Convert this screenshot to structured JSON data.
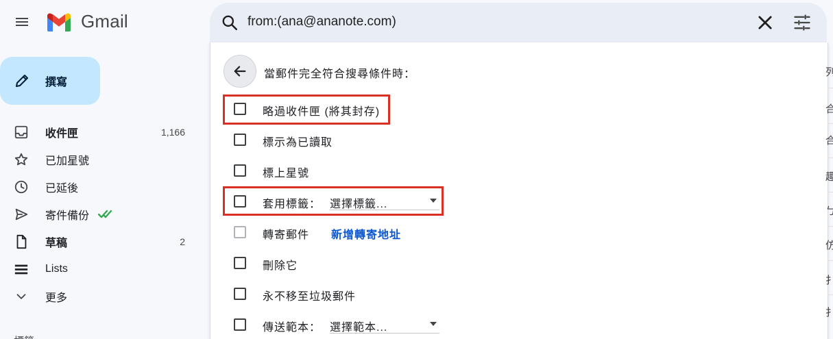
{
  "header": {
    "app_name": "Gmail",
    "search_query": "from:(ana@ananote.com)"
  },
  "sidebar": {
    "compose_label": "撰寫",
    "items": [
      {
        "label": "收件匣",
        "count": "1,166",
        "icon": "inbox-icon",
        "bold": true
      },
      {
        "label": "已加星號",
        "count": "",
        "icon": "star-icon",
        "bold": false
      },
      {
        "label": "已延後",
        "count": "",
        "icon": "clock-icon",
        "bold": false
      },
      {
        "label": "寄件備份",
        "count": "",
        "icon": "send-icon",
        "bold": false
      },
      {
        "label": "草稿",
        "count": "2",
        "icon": "draft-icon",
        "bold": true
      },
      {
        "label": "Lists",
        "count": "",
        "icon": "lists-icon",
        "bold": false
      },
      {
        "label": "更多",
        "count": "",
        "icon": "chevron-down-icon",
        "bold": false
      }
    ],
    "partial_label": "標籤"
  },
  "filter": {
    "title": "當郵件完全符合搜尋條件時：",
    "options": {
      "skip_inbox": "略過收件匣 (將其封存)",
      "mark_read": "標示為已讀取",
      "star_it": "標上星號",
      "apply_label": "套用標籤：",
      "apply_label_select": "選擇標籤...",
      "forward": "轉寄郵件",
      "forward_link": "新增轉寄地址",
      "delete": "刪除它",
      "never_spam": "永不移至垃圾郵件",
      "send_template": "傳送範本：",
      "send_template_select": "選擇範本..."
    }
  },
  "edge_glyphs": [
    "列",
    "合",
    "合",
    "趣",
    "ㄅ",
    "仿",
    "",
    "扌",
    "扌"
  ],
  "colors": {
    "background": "#f6f8fc",
    "search_bg": "#e9eef6",
    "compose_bg": "#c2e7ff",
    "highlight_box": "#d93025",
    "link": "#0b57d0",
    "sent_check": "#34a853"
  }
}
